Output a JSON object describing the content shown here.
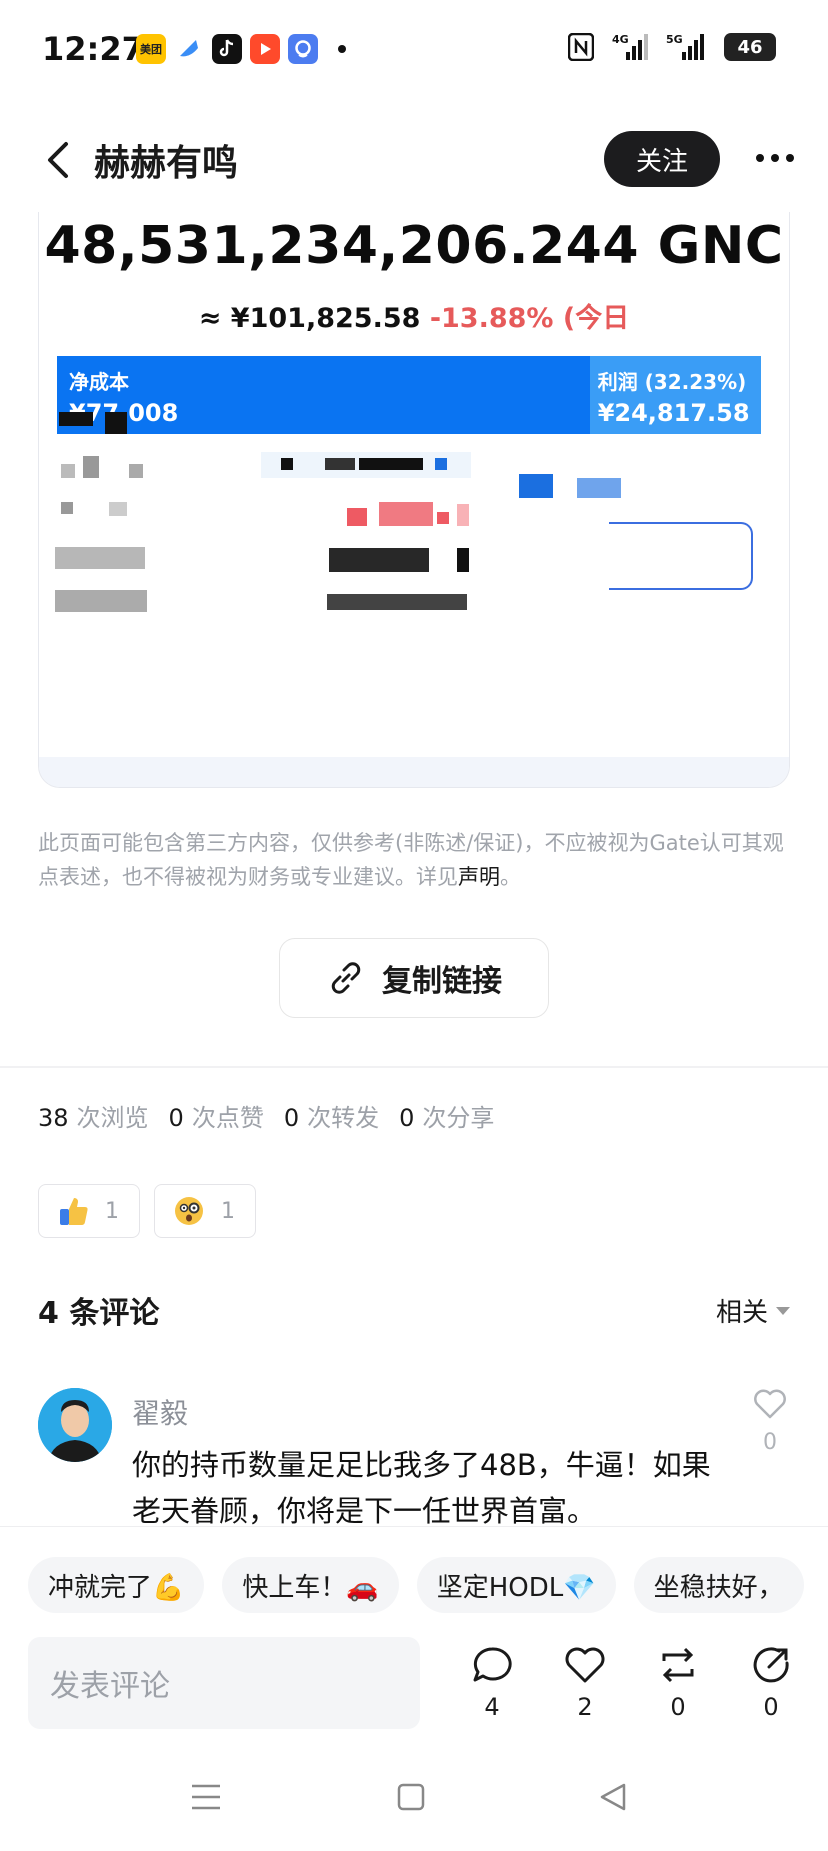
{
  "status_bar": {
    "time": "12:27",
    "app_icons": [
      {
        "name": "meituan-icon",
        "label": "美团",
        "color": "#ffc300"
      },
      {
        "name": "blue-app-icon",
        "label": "",
        "color": "#3a8ef6"
      },
      {
        "name": "tiktok-icon",
        "label": "",
        "color": "#111111"
      },
      {
        "name": "video-app-icon",
        "label": "",
        "color": "#ff4a2b"
      },
      {
        "name": "qq-icon",
        "label": "",
        "color": "#4c7cf0"
      }
    ],
    "network_1": "4G",
    "network_2": "5G",
    "battery": "46"
  },
  "header": {
    "title": "赫赫有鸣",
    "follow_label": "关注"
  },
  "post_card": {
    "amount": "48,531,234,206.244 GNC",
    "fiat_prefix": "≈ ¥101,825.58 ",
    "change": "-13.88% (今日",
    "cost_label": "净成本",
    "cost_value": "¥77,008",
    "profit_label": "利润 (32.23%)",
    "profit_value": "¥24,817.58",
    "cost_fraction": 0.7567
  },
  "disclaimer": {
    "text": "此页面可能包含第三方内容，仅供参考(非陈述/保证)，不应被视为Gate认可其观点表述，也不得被视为财务或专业建议。详见",
    "link": "声明",
    "end": "。"
  },
  "copy_link_label": "复制链接",
  "stats": [
    {
      "count": "38",
      "label": "次浏览"
    },
    {
      "count": "0",
      "label": "次点赞"
    },
    {
      "count": "0",
      "label": "次转发"
    },
    {
      "count": "0",
      "label": "次分享"
    }
  ],
  "reactions": [
    {
      "icon": "thumbs-up-icon",
      "count": "1"
    },
    {
      "icon": "surprised-face-icon",
      "count": "1"
    }
  ],
  "comments": {
    "title": "4 条评论",
    "sort_label": "相关",
    "items": [
      {
        "user": "翟毅",
        "text": "你的持币数量足足比我多了48B，牛逼！如果老天眷顾，你将是下一任世界首富。",
        "likes": "0"
      }
    ]
  },
  "quick_replies": [
    "冲就完了💪",
    "快上车！🚗",
    "坚定HODL💎",
    "坐稳扶好，"
  ],
  "composer": {
    "placeholder": "发表评论",
    "actions": [
      {
        "icon": "comment-icon",
        "count": "4"
      },
      {
        "icon": "heart-icon",
        "count": "2"
      },
      {
        "icon": "repost-icon",
        "count": "0"
      },
      {
        "icon": "share-icon",
        "count": "0"
      }
    ]
  },
  "colors": {
    "accent_blue": "#0a74f2",
    "profit_blue": "#3a9df6",
    "negative_red": "#e65a5a",
    "follow_button": "#1c1c1e"
  }
}
